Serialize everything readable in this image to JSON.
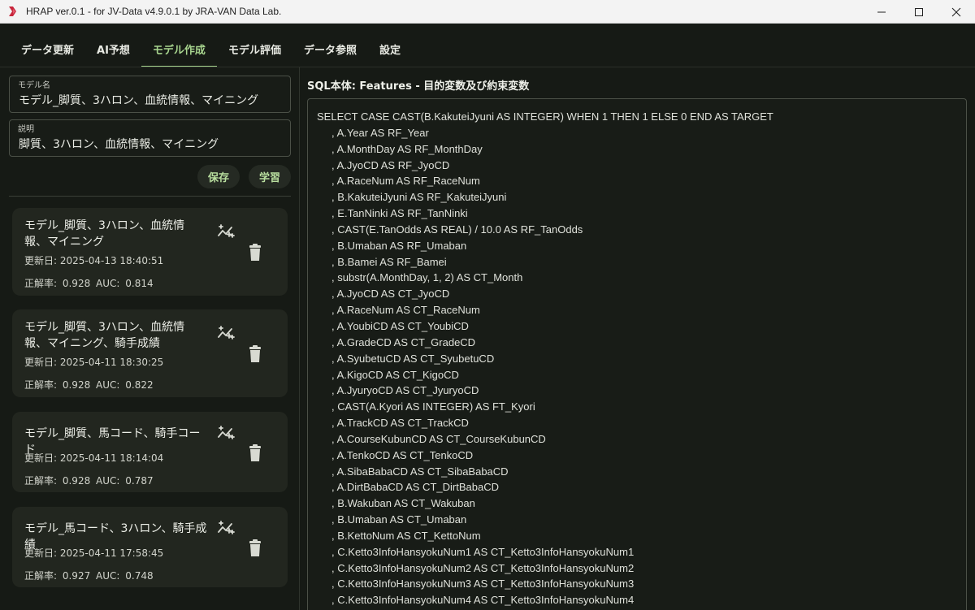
{
  "window": {
    "title": "HRAP ver.0.1 - for JV-Data v4.9.0.1 by JRA-VAN Data Lab.",
    "minimize_icon": "minimize-icon",
    "maximize_icon": "maximize-icon",
    "close_icon": "close-icon"
  },
  "tabs": [
    {
      "label": "データ更新"
    },
    {
      "label": "AI予想"
    },
    {
      "label": "モデル作成",
      "active": true
    },
    {
      "label": "モデル評価"
    },
    {
      "label": "データ参照"
    },
    {
      "label": "設定"
    }
  ],
  "form": {
    "model_name_label": "モデル名",
    "model_name_value": "モデル_脚質、3ハロン、血統情報、マイニング",
    "description_label": "説明",
    "description_value": "脚質、3ハロン、血統情報、マイニング",
    "save_label": "保存",
    "train_label": "学習"
  },
  "models": [
    {
      "title": "モデル_脚質、3ハロン、血統情報、マイニング",
      "date": "更新日: 2025-04-13 18:40:51",
      "metrics": "正解率: 0.928 AUC: 0.814"
    },
    {
      "title": "モデル_脚質、3ハロン、血統情報、マイニング、騎手成績",
      "date": "更新日: 2025-04-11 18:30:25",
      "metrics": "正解率: 0.928 AUC: 0.822"
    },
    {
      "title": "モデル_脚質、馬コード、騎手コード",
      "date": "更新日: 2025-04-11 18:14:04",
      "metrics": "正解率: 0.928 AUC: 0.787"
    },
    {
      "title": "モデル_馬コード、3ハロン、騎手成績",
      "date": "更新日: 2025-04-11 17:58:45",
      "metrics": "正解率: 0.927 AUC: 0.748"
    }
  ],
  "sql": {
    "heading": "SQL本体: Features - 目的変数及び約束変数",
    "lines": [
      "SELECT CASE CAST(B.KakuteiJyuni AS INTEGER) WHEN 1 THEN 1 ELSE 0 END AS TARGET",
      "     , A.Year AS RF_Year",
      "     , A.MonthDay AS RF_MonthDay",
      "     , A.JyoCD AS RF_JyoCD",
      "     , A.RaceNum AS RF_RaceNum",
      "     , B.KakuteiJyuni AS RF_KakuteiJyuni",
      "     , E.TanNinki AS RF_TanNinki",
      "     , CAST(E.TanOdds AS REAL) / 10.0 AS RF_TanOdds",
      "     , B.Umaban AS RF_Umaban",
      "     , B.Bamei AS RF_Bamei",
      "     , substr(A.MonthDay, 1, 2) AS CT_Month",
      "     , A.JyoCD AS CT_JyoCD",
      "     , A.RaceNum AS CT_RaceNum",
      "     , A.YoubiCD AS CT_YoubiCD",
      "     , A.GradeCD AS CT_GradeCD",
      "     , A.SyubetuCD AS CT_SyubetuCD",
      "     , A.KigoCD AS CT_KigoCD",
      "     , A.JyuryoCD AS CT_JyuryoCD",
      "     , CAST(A.Kyori AS INTEGER) AS FT_Kyori",
      "     , A.TrackCD AS CT_TrackCD",
      "     , A.CourseKubunCD AS CT_CourseKubunCD",
      "     , A.TenkoCD AS CT_TenkoCD",
      "     , A.SibaBabaCD AS CT_SibaBabaCD",
      "     , A.DirtBabaCD AS CT_DirtBabaCD",
      "     , B.Wakuban AS CT_Wakuban",
      "     , B.Umaban AS CT_Umaban",
      "     , B.KettoNum AS CT_KettoNum",
      "     , C.Ketto3InfoHansyokuNum1 AS CT_Ketto3InfoHansyokuNum1",
      "     , C.Ketto3InfoHansyokuNum2 AS CT_Ketto3InfoHansyokuNum2",
      "     , C.Ketto3InfoHansyokuNum3 AS CT_Ketto3InfoHansyokuNum3",
      "     , C.Ketto3InfoHansyokuNum4 AS CT_Ketto3InfoHansyokuNum4"
    ]
  },
  "colors": {
    "accent": "#a7d48e",
    "background": "#161a15",
    "card": "#22261f"
  }
}
